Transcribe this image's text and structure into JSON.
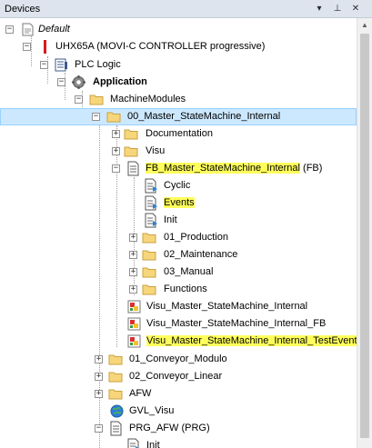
{
  "panel": {
    "title": "Devices",
    "menu_icon": "▾",
    "pin_icon": "⊥",
    "close_icon": "✕"
  },
  "tree": {
    "root": "Default",
    "controller": "UHX65A (MOVI-C CONTROLLER progressive)",
    "plc_logic": "PLC Logic",
    "application": "Application",
    "machine_modules": "MachineModules",
    "master_folder": "00_Master_StateMachine_Internal",
    "documentation": "Documentation",
    "visu": "Visu",
    "fb_name": "FB_Master_StateMachine_Internal",
    "fb_suffix": " (FB)",
    "cyclic": "Cyclic",
    "events": "Events",
    "init": "Init",
    "production": "01_Production",
    "maintenance": "02_Maintenance",
    "manual": "03_Manual",
    "functions": "Functions",
    "visu_internal": "Visu_Master_StateMachine_Internal",
    "visu_internal_fb": "Visu_Master_StateMachine_Internal_FB",
    "visu_test_events": "Visu_Master_StateMachine_Internal_TestEvents",
    "conveyor_modulo": "01_Conveyor_Modulo",
    "conveyor_linear": "02_Conveyor_Linear",
    "afw": "AFW",
    "gvl_visu": "GVL_Visu",
    "prg_afw": "PRG_AFW (PRG)",
    "prg_init": "Init"
  }
}
